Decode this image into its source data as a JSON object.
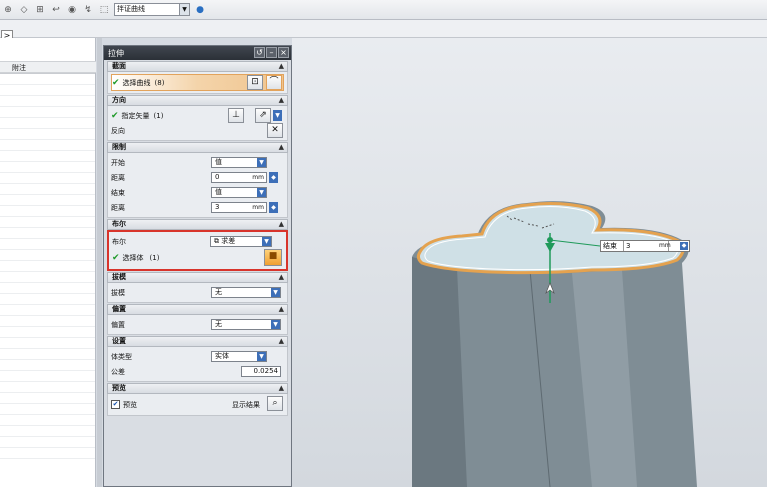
{
  "toolbar": {
    "filter_value": "拌证曲线",
    "icons": [
      "axis-icon",
      "sketch-icon",
      "snap-icon",
      "arrow-icon",
      "view-icon",
      "transform-icon",
      "select-icon",
      "globe-icon"
    ]
  },
  "left_panel": {
    "expand_label": ">",
    "column_header": "附注"
  },
  "dialog": {
    "title": "拉伸",
    "sections": {
      "section": {
        "header": "截面",
        "select_curve": "选择曲线",
        "select_curve_count": "(8)"
      },
      "direction": {
        "header": "方向",
        "specify_vector": "指定矢量",
        "specify_vector_count": "(1)",
        "reverse": "反向"
      },
      "limits": {
        "header": "限制",
        "start_label": "开始",
        "start_value": "值",
        "start_distance_label": "距离",
        "start_distance_value": "0",
        "end_label": "结束",
        "end_value": "值",
        "end_distance_label": "距离",
        "end_distance_value": "3",
        "unit": "mm"
      },
      "boolean": {
        "header": "布尔",
        "boolean_label": "布尔",
        "boolean_value": "求差",
        "select_body": "选择体",
        "select_body_count": "(1)"
      },
      "draft": {
        "header": "拔模",
        "draft_label": "拔模",
        "draft_value": "无"
      },
      "offset": {
        "header": "偏置",
        "offset_label": "偏置",
        "offset_value": "无"
      },
      "settings": {
        "header": "设置",
        "body_type_label": "体类型",
        "body_type_value": "实体",
        "tolerance_label": "公差",
        "tolerance_value": "0.0254"
      },
      "preview": {
        "header": "预览",
        "preview_label": "预览",
        "show_result": "显示结果"
      }
    }
  },
  "viewport": {
    "end_label": "结束",
    "end_value": "3",
    "end_unit": "mm"
  },
  "colors": {
    "highlight_border": "#e2a35c",
    "boolean_box": "#d8342b",
    "model_body": "#7f8d95",
    "model_top": "#cfe0e6",
    "model_edge": "#e4a24f",
    "vector_arrow": "#1f9a5a"
  }
}
